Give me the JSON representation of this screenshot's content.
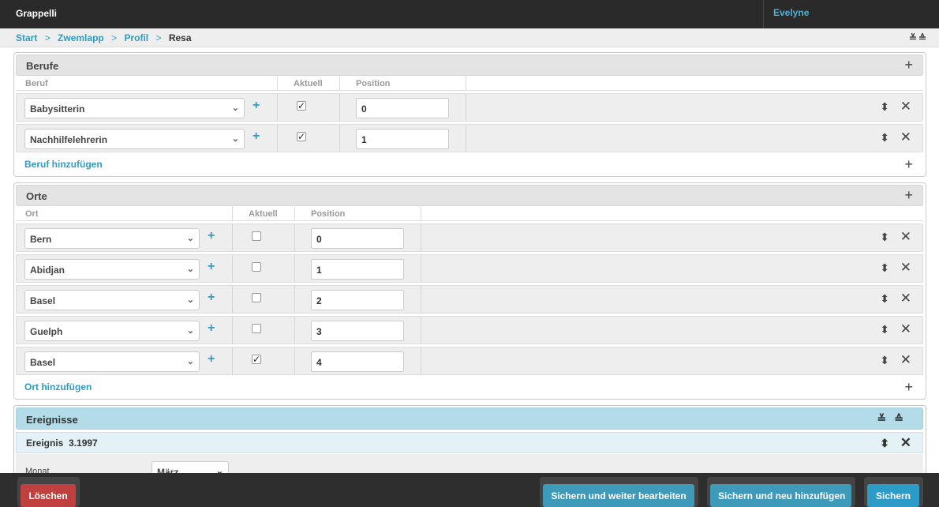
{
  "header": {
    "brand": "Grappelli",
    "user": "Evelyne"
  },
  "breadcrumb": {
    "items": [
      "Start",
      "Zwemlapp",
      "Profil"
    ],
    "current": "Resa",
    "sep": ">",
    "tools": "⌄⌃"
  },
  "berufe": {
    "title": "Berufe",
    "plus": "+",
    "cols": {
      "name": "Beruf",
      "aktuell": "Aktuell",
      "position": "Position"
    },
    "rows": [
      {
        "value": "Babysitterin",
        "aktuell": true,
        "position": "0"
      },
      {
        "value": "Nachhilfelehrerin",
        "aktuell": true,
        "position": "1"
      }
    ],
    "add_label": "Beruf hinzufügen"
  },
  "orte": {
    "title": "Orte",
    "plus": "+",
    "cols": {
      "name": "Ort",
      "aktuell": "Aktuell",
      "position": "Position"
    },
    "rows": [
      {
        "value": "Bern",
        "aktuell": false,
        "position": "0"
      },
      {
        "value": "Abidjan",
        "aktuell": false,
        "position": "1"
      },
      {
        "value": "Basel",
        "aktuell": false,
        "position": "2"
      },
      {
        "value": "Guelph",
        "aktuell": false,
        "position": "3"
      },
      {
        "value": "Basel",
        "aktuell": true,
        "position": "4"
      }
    ],
    "add_label": "Ort hinzufügen"
  },
  "ereignisse": {
    "title": "Ereignisse",
    "item_title": "Ereignis  3.1997",
    "monat_label": "Monat",
    "monat_value": "März"
  },
  "footer": {
    "delete": "Löschen",
    "save_continue": "Sichern und weiter bearbeiten",
    "save_add": "Sichern und neu hinzufügen",
    "save": "Sichern"
  },
  "colors": {
    "accent": "#309bbf",
    "delete": "#c04040",
    "header": "#2a2a2a"
  }
}
